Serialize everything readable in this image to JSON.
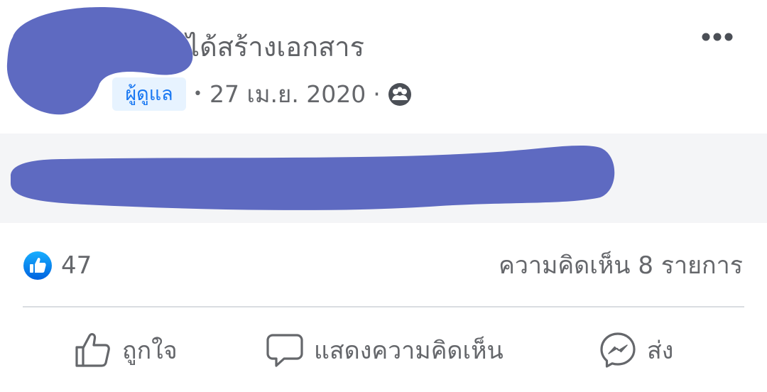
{
  "post": {
    "title": "ได้สร้างเอกสาร",
    "badge": "ผู้ดูแล",
    "separator": "•",
    "date": "27 เม.ย. 2020",
    "dot": "·",
    "privacy_icon": "group-icon"
  },
  "stats": {
    "like_count": "47",
    "comment_count": "ความคิดเห็น 8 รายการ"
  },
  "actions": {
    "like_label": "ถูกใจ",
    "comment_label": "แสดงความคิดเห็น",
    "share_label": "ส่ง"
  },
  "colors": {
    "redaction": "#5e6ac1",
    "like_blue": "#1877f2",
    "badge_bg": "#e7f3ff",
    "text_secondary": "#65676b"
  }
}
